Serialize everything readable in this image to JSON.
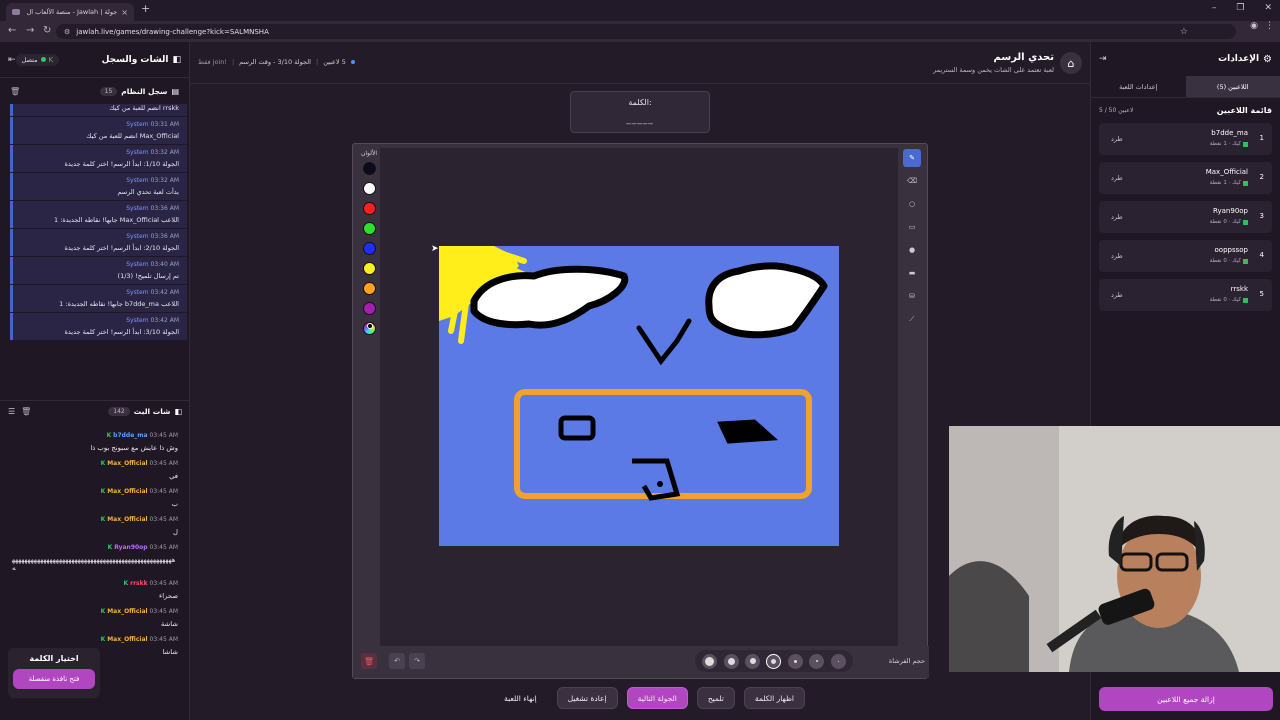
{
  "browser": {
    "tab_title": "جولة | Jawlah - منصة الألعاب ال",
    "url": "jawlah.live/games/drawing-challenge?kick=SALMNSHA"
  },
  "left": {
    "title": "الشات والسجل",
    "status": "متصل",
    "system_log": {
      "title": "سجل النظام",
      "count": "15",
      "items": [
        {
          "time": "",
          "text": "rrskk انضم للعبة من كيك"
        },
        {
          "time": "03:31 AM",
          "name": "System",
          "text": "Max_Official انضم للعبة من كيك"
        },
        {
          "time": "03:32 AM",
          "name": "System",
          "text": "الجولة 1/10: ابدأ الرسم! اختر كلمة جديدة"
        },
        {
          "time": "03:32 AM",
          "name": "System",
          "text": "بدأت لعبة تحدي الرسم"
        },
        {
          "time": "03:36 AM",
          "name": "System",
          "text": "اللاعب Max_Official جابها! نقاطه الجديدة: 1"
        },
        {
          "time": "03:36 AM",
          "name": "System",
          "text": "الجولة 2/10: ابدأ الرسم! اختر كلمة جديدة"
        },
        {
          "time": "03:40 AM",
          "name": "System",
          "text": "تم إرسال تلميح! (1/3)"
        },
        {
          "time": "03:42 AM",
          "name": "System",
          "text": "اللاعب b7dde_ma جابها! نقاطه الجديدة: 1"
        },
        {
          "time": "03:42 AM",
          "name": "System",
          "text": "الجولة 3/10: ابدأ الرسم! اختر كلمة جديدة"
        }
      ]
    },
    "stream_chat": {
      "title": "شات البث",
      "count": "142",
      "messages": [
        {
          "user": "b7dde_ma",
          "color": "#5aa0ff",
          "time": "03:45 AM",
          "text": "وش ذا عايش مع سبونج بوب ذا"
        },
        {
          "user": "Max_Official",
          "color": "#f2b03a",
          "time": "03:45 AM",
          "text": "في"
        },
        {
          "user": "Max_Official",
          "color": "#f2b03a",
          "time": "03:45 AM",
          "text": "ب"
        },
        {
          "user": "Max_Official",
          "color": "#f2b03a",
          "time": "03:45 AM",
          "text": "ل"
        },
        {
          "user": "Ryan90op",
          "color": "#b76cff",
          "time": "03:45 AM",
          "text": "ههههههههههههههههههههههههههههههههههههههههههههههههههههه"
        },
        {
          "user": "rrskk",
          "color": "#ff4d6a",
          "time": "03:45 AM",
          "text": "صحراء"
        },
        {
          "user": "Max_Official",
          "color": "#f2b03a",
          "time": "03:45 AM",
          "text": "شاشة"
        },
        {
          "user": "Max_Official",
          "color": "#f2b03a",
          "time": "03:45 AM",
          "text": "شاشا"
        }
      ]
    },
    "pick_word": {
      "title": "اختيار الكلمة",
      "button": "فتح نافذة منفصلة"
    }
  },
  "center": {
    "game_title": "تحدي الرسم",
    "game_subtitle": "لعبة تعتمد على الشات يخمن وسمة الستريمر",
    "round_info": {
      "players": "5 لاعبين",
      "round": "الجولة 3/10 - وقت الرسم",
      "join": "!join فقط"
    },
    "word_label": "الكلمة:",
    "word_blank": "_____",
    "colors_label": "الألوان",
    "palette": [
      "#0b0b1f",
      "#ffffff",
      "#ff1f1f",
      "#2ee02e",
      "#1f2cff",
      "#ffef1f",
      "#ffa21f",
      "#a21fb0"
    ],
    "brush_label": "حجم الفرشاة",
    "actions": {
      "end": "إنهاء اللعبة",
      "restart": "إعادة تشغيل",
      "next": "الجولة التالية",
      "hint": "تلميح",
      "show": "اظهار الكلمة"
    }
  },
  "right": {
    "title": "الإعدادات",
    "tabs": [
      "اللاعبين (5)",
      "إعدادات اللعبة"
    ],
    "players_title": "قائمة اللاعبين",
    "players_count": "5 / 50 لاعبين",
    "kick_label": "طرد",
    "players": [
      {
        "rank": "1",
        "name": "b7dde_ma",
        "score": "كيك · 1 نقطة"
      },
      {
        "rank": "2",
        "name": "Max_Official",
        "score": "كيك · 1 نقطة"
      },
      {
        "rank": "3",
        "name": "Ryan90op",
        "score": "كيك · 0 نقطة"
      },
      {
        "rank": "4",
        "name": "ooppssop",
        "score": "كيك · 0 نقطة"
      },
      {
        "rank": "5",
        "name": "rrskk",
        "score": "كيك · 0 نقطة"
      }
    ],
    "remove_all": "إزالة جميع اللاعبين"
  }
}
